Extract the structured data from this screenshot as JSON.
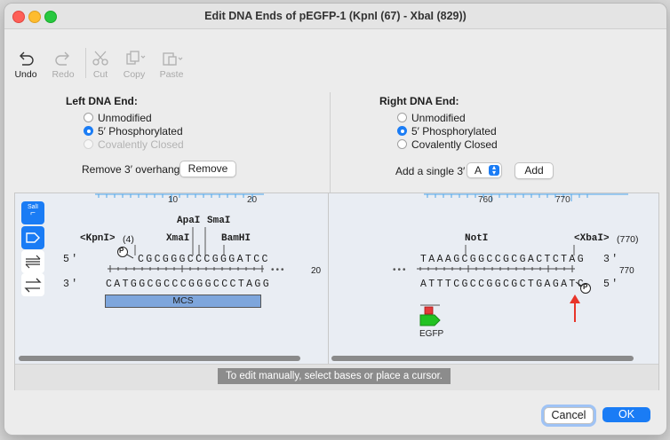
{
  "window": {
    "title": "Edit DNA Ends of pEGFP-1 (KpnI (67) - XbaI (829))"
  },
  "toolbar": {
    "undo": "Undo",
    "redo": "Redo",
    "cut": "Cut",
    "copy": "Copy",
    "paste": "Paste"
  },
  "left": {
    "header": "Left DNA End:",
    "options": [
      "Unmodified",
      "5′ Phosphorylated",
      "Covalently Closed"
    ],
    "selected": "5′ Phosphorylated",
    "remove_label": "Remove 3′ overhang",
    "remove_button": "Remove"
  },
  "right": {
    "header": "Right DNA End:",
    "options": [
      "Unmodified",
      "5′ Phosphorylated",
      "Covalently Closed"
    ],
    "selected": "5′ Phosphorylated",
    "add_label": "Add a single 3′",
    "base_value": "A",
    "add_button": "Add"
  },
  "seq_left": {
    "ruler_ticks": [
      "10",
      "20"
    ],
    "tools": [
      "SalI"
    ],
    "enzymes": {
      "kpni": "<KpnI>",
      "kpni_pos": "(4)",
      "apai": "ApaI",
      "smai": "SmaI",
      "xmai": "XmaI",
      "bamhi": "BamHI"
    },
    "top_label": "5'",
    "bottom_label": "3'",
    "top_seq": "CGCGGGCCCGGGATCC",
    "bottom_seq": "CATGGCGCCCGGGCCCTAGG",
    "end_num": "20",
    "feature": "MCS",
    "phos_mark": "P",
    "ellipsis": "•••"
  },
  "seq_right": {
    "ruler_ticks": [
      "760",
      "770"
    ],
    "enzymes": {
      "noti": "NotI",
      "xbai": "<XbaI>",
      "xbai_pos": "(770)"
    },
    "top_label": "3'",
    "bottom_label": "5'",
    "top_seq": "TAAAGCGGCCGCGACTCTAG",
    "bottom_seq": "ATTTCGCCGGCGCTGAGATC",
    "end_num": "770",
    "feature": "EGFP",
    "phos_mark": "P",
    "ellipsis": "•••"
  },
  "hint": "To edit manually, select bases or place a cursor.",
  "footer": {
    "cancel": "Cancel",
    "ok": "OK"
  },
  "colors": {
    "accent": "#1a7cf5",
    "mcs": "#7ea6dc",
    "egfp": "#22c222",
    "arrow": "#e8352a"
  }
}
